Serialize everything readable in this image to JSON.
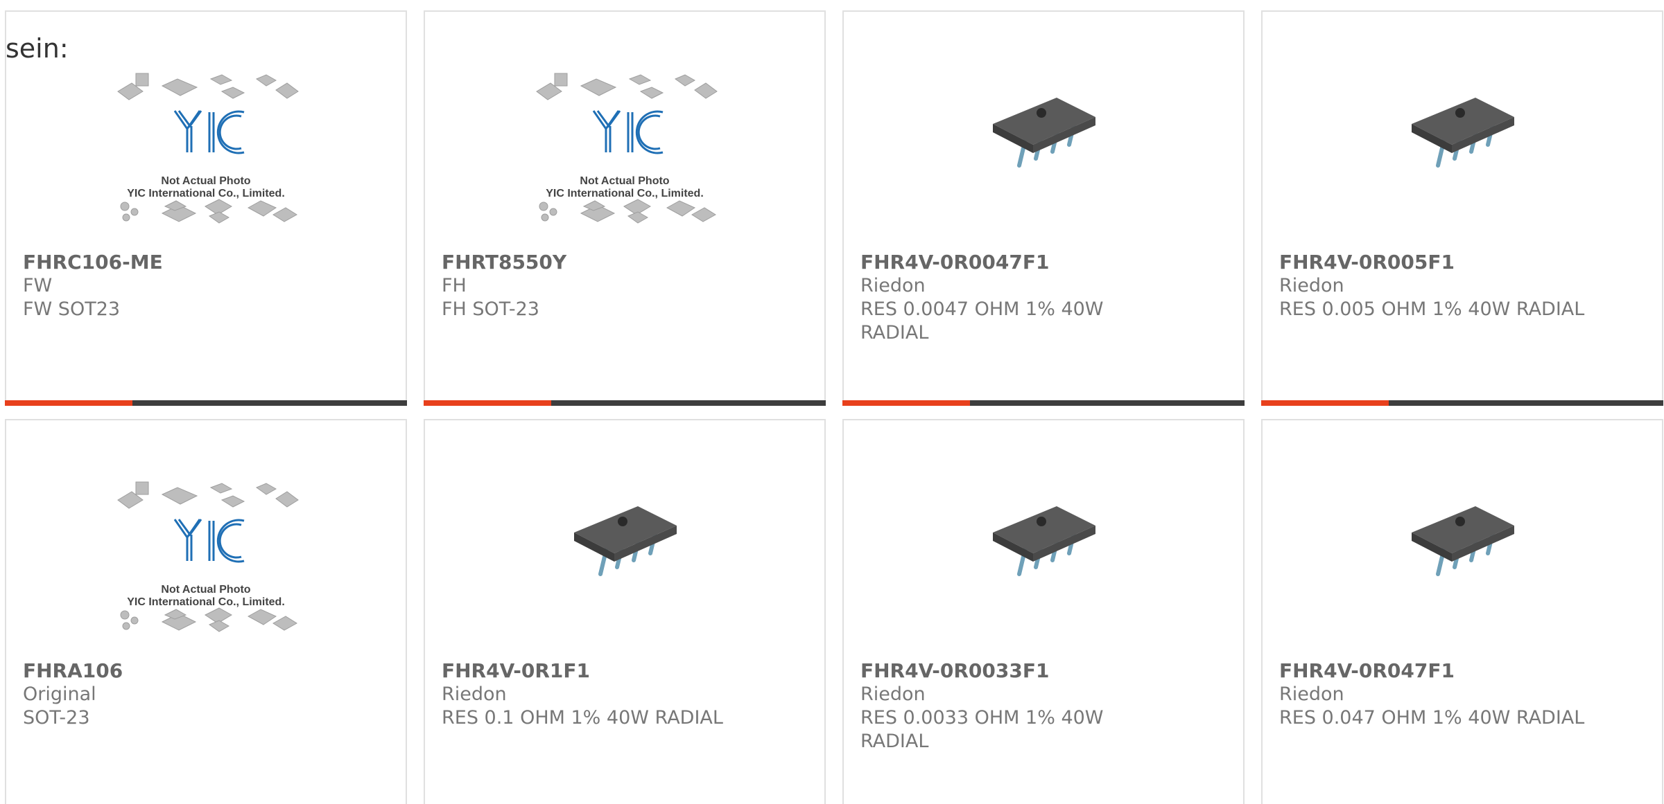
{
  "intro": "sein:",
  "placeholder": {
    "line1": "Not Actual Photo",
    "line2": "YIC International Co., Limited."
  },
  "colors": {
    "accent": "#e8401c",
    "bar": "#3d3d3d",
    "logo": "#1f6fb5"
  },
  "products": [
    {
      "part": "FHRC106-ME",
      "maker": "FW",
      "desc": "FW SOT23",
      "desc2": "",
      "image": "placeholder-photo"
    },
    {
      "part": "FHRT8550Y",
      "maker": "FH",
      "desc": "FH SOT-23",
      "desc2": "",
      "image": "placeholder-photo"
    },
    {
      "part": "FHR4V-0R0047F1",
      "maker": "Riedon",
      "desc": "RES 0.0047 OHM 1% 40W",
      "desc2": "RADIAL",
      "image": "resistor-chip"
    },
    {
      "part": "FHR4V-0R005F1",
      "maker": "Riedon",
      "desc": "RES 0.005 OHM 1% 40W RADIAL",
      "desc2": "",
      "image": "resistor-chip"
    },
    {
      "part": "FHRA106",
      "maker": "Original",
      "desc": "SOT-23",
      "desc2": "",
      "image": "placeholder-photo"
    },
    {
      "part": "FHR4V-0R1F1",
      "maker": "Riedon",
      "desc": "RES 0.1 OHM 1% 40W RADIAL",
      "desc2": "",
      "image": "resistor-chip"
    },
    {
      "part": "FHR4V-0R0033F1",
      "maker": "Riedon",
      "desc": "RES 0.0033 OHM 1% 40W",
      "desc2": "RADIAL",
      "image": "resistor-chip"
    },
    {
      "part": "FHR4V-0R047F1",
      "maker": "Riedon",
      "desc": "RES 0.047 OHM 1% 40W RADIAL",
      "desc2": "",
      "image": "resistor-chip"
    }
  ]
}
